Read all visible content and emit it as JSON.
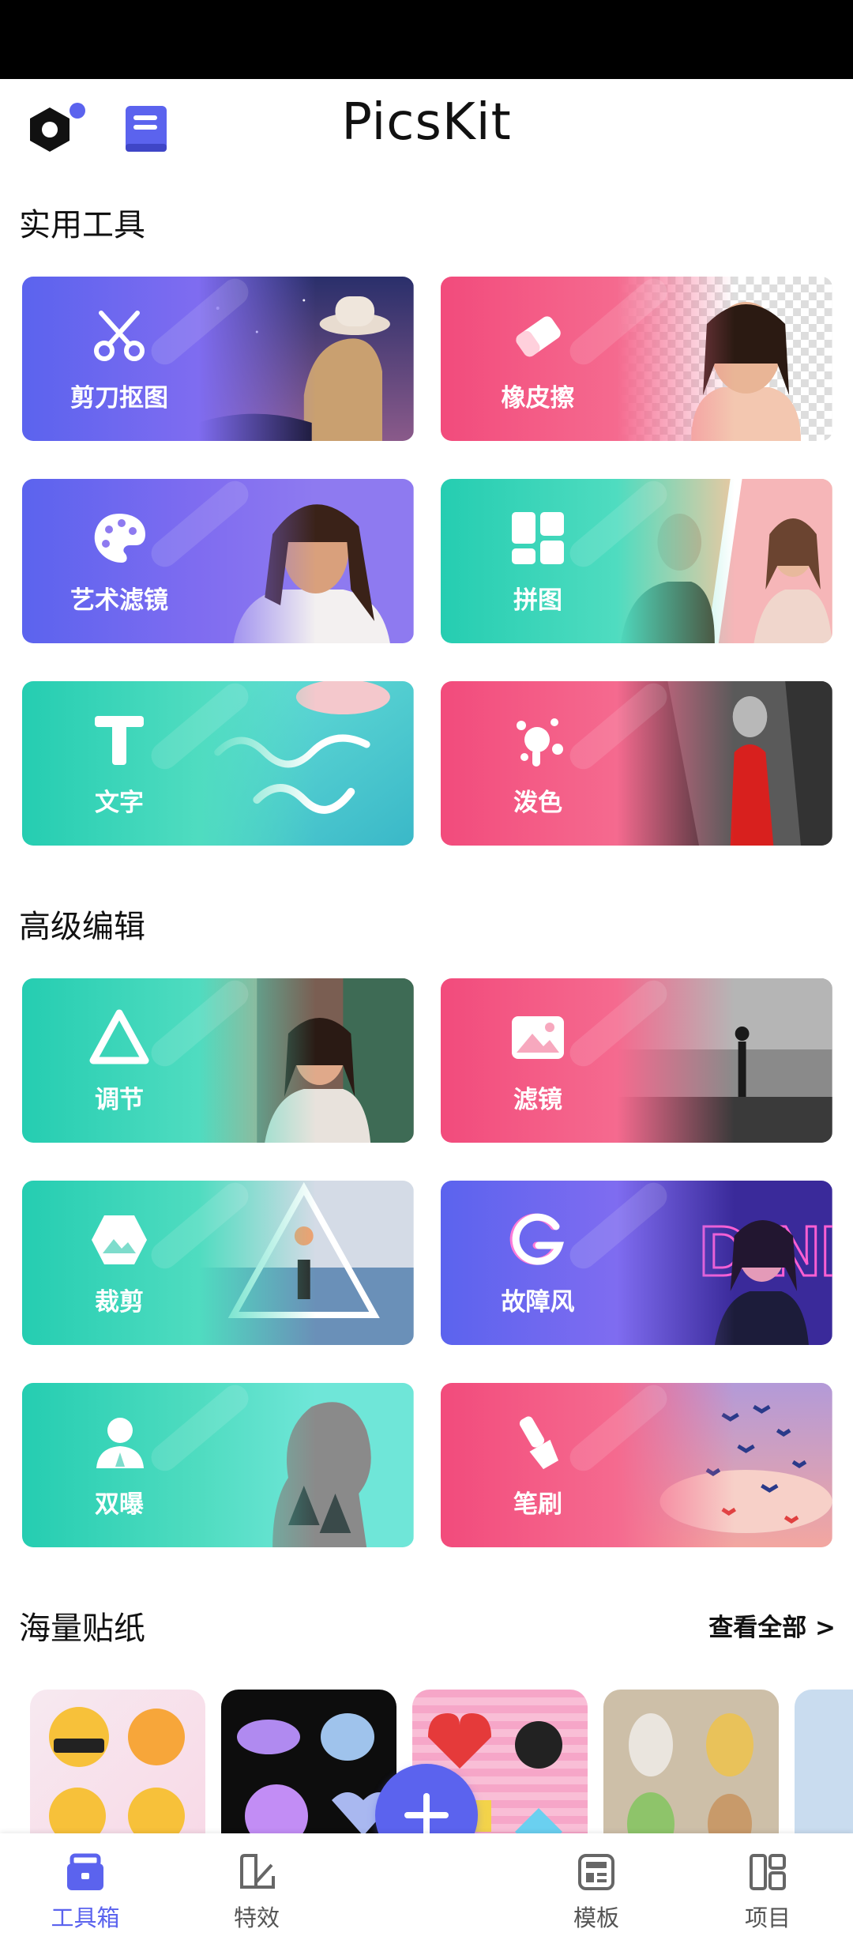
{
  "app": {
    "title": "PicsKit"
  },
  "sections": {
    "tools": "实用工具",
    "advanced": "高级编辑",
    "stickers": "海量贴纸",
    "see_all": "查看全部 >"
  },
  "tools": [
    {
      "label": "剪刀抠图",
      "icon": "scissors-icon",
      "gradient": "purple"
    },
    {
      "label": "橡皮擦",
      "icon": "eraser-icon",
      "gradient": "pink"
    },
    {
      "label": "艺术滤镜",
      "icon": "palette-icon",
      "gradient": "purple"
    },
    {
      "label": "拼图",
      "icon": "collage-icon",
      "gradient": "teal"
    },
    {
      "label": "文字",
      "icon": "text-icon",
      "gradient": "teal"
    },
    {
      "label": "泼色",
      "icon": "splash-icon",
      "gradient": "pink"
    }
  ],
  "advanced": [
    {
      "label": "调节",
      "icon": "adjust-icon",
      "gradient": "teal"
    },
    {
      "label": "滤镜",
      "icon": "filter-icon",
      "gradient": "pink"
    },
    {
      "label": "裁剪",
      "icon": "crop-icon",
      "gradient": "teal"
    },
    {
      "label": "故障风",
      "icon": "glitch-icon",
      "gradient": "purple"
    },
    {
      "label": "双曝",
      "icon": "double-exposure-icon",
      "gradient": "teal"
    },
    {
      "label": "笔刷",
      "icon": "brush-icon",
      "gradient": "pink"
    }
  ],
  "tabs": [
    {
      "label": "工具箱",
      "icon": "toolbox-icon",
      "active": true
    },
    {
      "label": "特效",
      "icon": "effects-icon",
      "active": false
    },
    {
      "label": "模板",
      "icon": "template-icon",
      "active": false
    },
    {
      "label": "项目",
      "icon": "project-icon",
      "active": false
    }
  ],
  "colors": {
    "accent": "#5b63ee",
    "pink": "#f24b7c",
    "teal": "#25cdb1",
    "purple": "#6a66ef"
  }
}
